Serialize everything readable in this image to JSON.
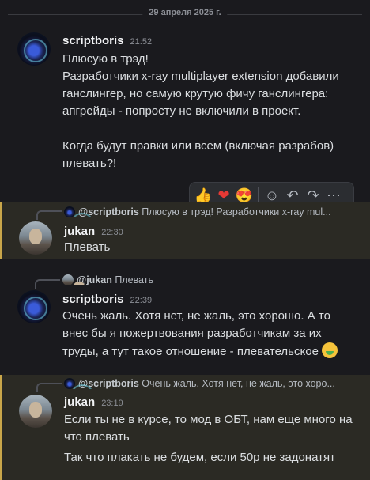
{
  "date_divider": "29 апреля 2025 г.",
  "messages": [
    {
      "author": "scriptboris",
      "time": "21:52",
      "text": "Плюсую в трэд!\nРазработчики x-ray multiplayer extension добавили ганслингер, но самую крутую фичу ганслингера: апгрейды - попросту не включили в проект.\n\nКогда будут правки или всем (включая разрабов) плевать?!"
    },
    {
      "reply_author": "@scriptboris",
      "reply_text": "Плюсую в трэд!  Разработчики x-ray mul...",
      "author": "jukan",
      "time": "22:30",
      "text": "Плевать"
    },
    {
      "reply_author": "@jukan",
      "reply_text": "Плевать",
      "author": "scriptboris",
      "time": "22:39",
      "text": "Очень жаль. Хотя нет, не жаль, это хорошо. А то внес бы я пожертвования разработчикам за их труды, а тут такое отношение - плевательское",
      "trailing_emoji": "nauseated-face"
    },
    {
      "reply_author": "@scriptboris",
      "reply_text": "Очень жаль. Хотя нет, не жаль, это хоро...",
      "author": "jukan",
      "time": "23:19",
      "text": "Если ты не в курсе, то мод в ОБТ, нам еще много на что плевать",
      "followup_text": "Так что плакать не будем, если 50р не задонатят"
    }
  ],
  "toolbar": {
    "reactions": [
      "👍",
      "❤",
      "😍"
    ],
    "actions": [
      "add-reaction-icon",
      "reply-icon",
      "forward-icon",
      "more-icon"
    ],
    "glyphs": [
      "☺",
      "↶",
      "↷",
      "⋯"
    ]
  }
}
